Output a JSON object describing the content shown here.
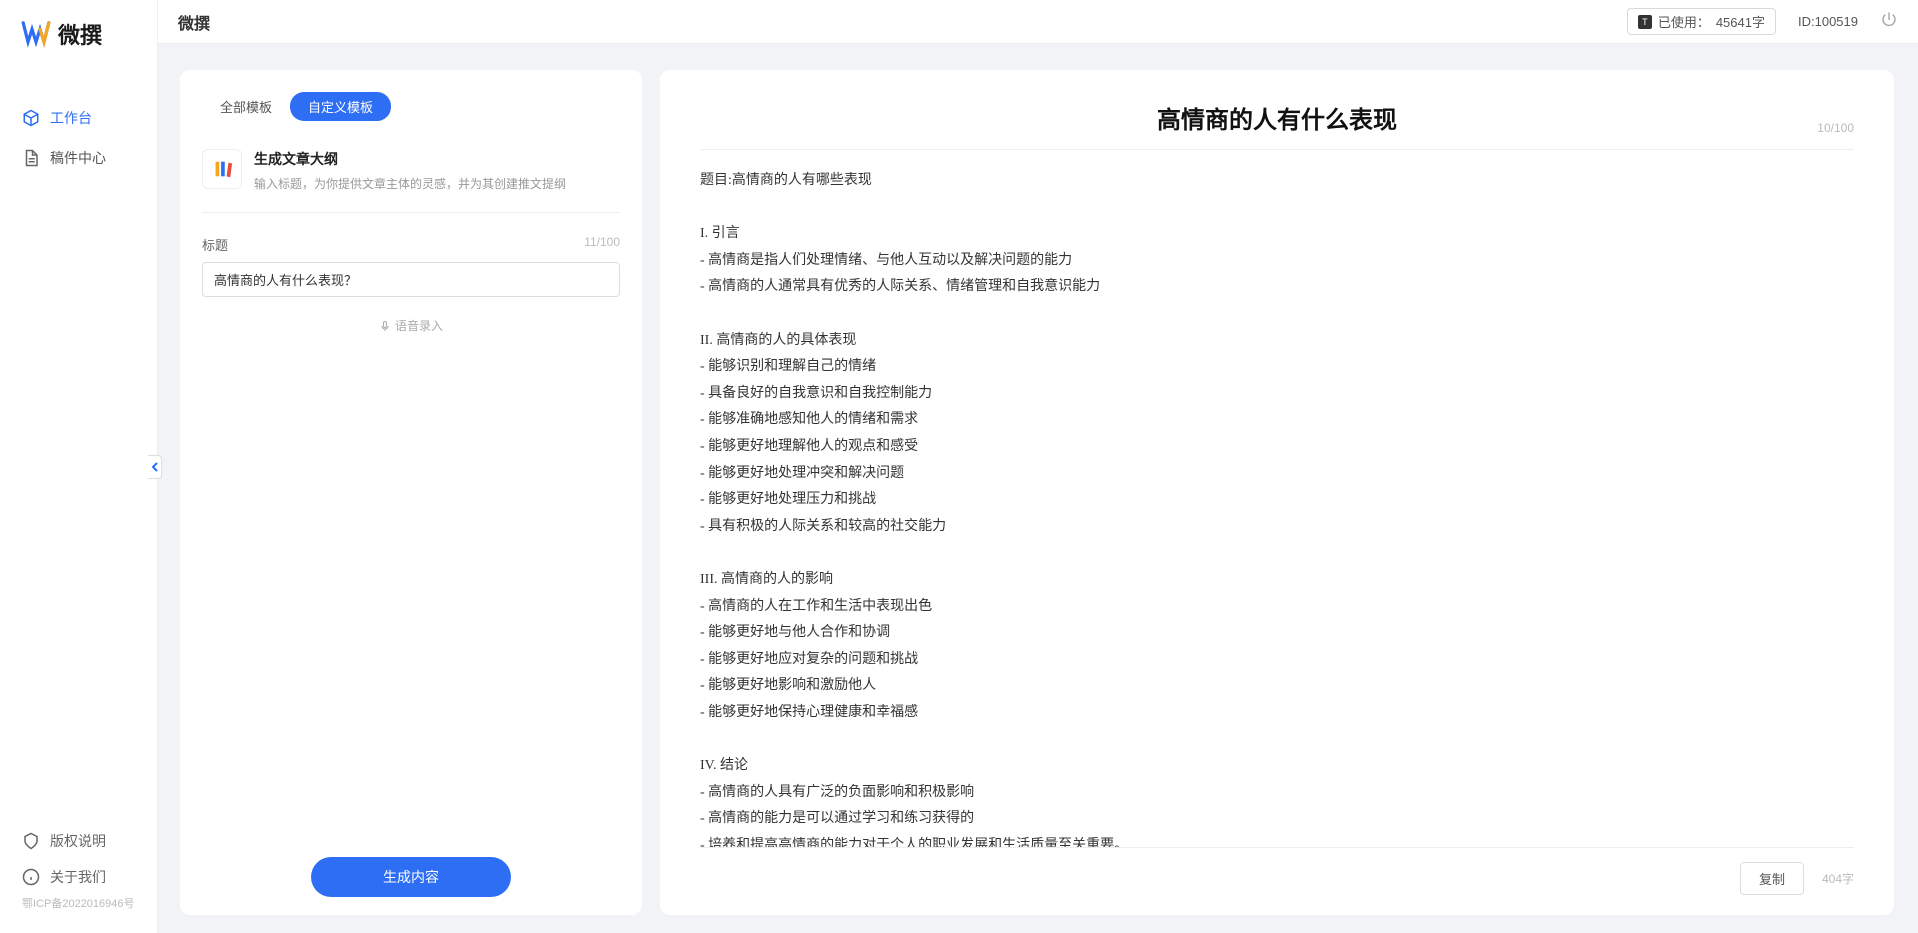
{
  "app": {
    "name": "微撰"
  },
  "sidebar": {
    "logo_text": "微撰",
    "nav": [
      {
        "icon": "cube",
        "label": "工作台",
        "active": true
      },
      {
        "icon": "doc",
        "label": "稿件中心",
        "active": false
      }
    ],
    "footer": [
      {
        "icon": "shield",
        "label": "版权说明"
      },
      {
        "icon": "info",
        "label": "关于我们"
      }
    ],
    "icp": "鄂ICP备2022016946号"
  },
  "topbar": {
    "title": "微撰",
    "usage_label": "已使用：",
    "usage_value": "45641字",
    "id_label": "ID:",
    "id_value": "100519"
  },
  "left_panel": {
    "tabs": [
      "全部模板",
      "自定义模板"
    ],
    "active_tab": 1,
    "template": {
      "title": "生成文章大纲",
      "desc": "输入标题，为你提供文章主体的灵感，并为其创建推文提纲"
    },
    "field_label": "标题",
    "char_count": "11/100",
    "input_value": "高情商的人有什么表现？",
    "record_hint": "语音录入",
    "generate_label": "生成内容"
  },
  "right_panel": {
    "title": "高情商的人有什么表现",
    "title_count": "10/100",
    "body": "题目:高情商的人有哪些表现\n\nI. 引言\n- 高情商是指人们处理情绪、与他人互动以及解决问题的能力\n- 高情商的人通常具有优秀的人际关系、情绪管理和自我意识能力\n\nII. 高情商的人的具体表现\n- 能够识别和理解自己的情绪\n- 具备良好的自我意识和自我控制能力\n- 能够准确地感知他人的情绪和需求\n- 能够更好地理解他人的观点和感受\n- 能够更好地处理冲突和解决问题\n- 能够更好地处理压力和挑战\n- 具有积极的人际关系和较高的社交能力\n\nIII. 高情商的人的影响\n- 高情商的人在工作和生活中表现出色\n- 能够更好地与他人合作和协调\n- 能够更好地应对复杂的问题和挑战\n- 能够更好地影响和激励他人\n- 能够更好地保持心理健康和幸福感\n\nIV. 结论\n- 高情商的人具有广泛的负面影响和积极影响\n- 高情商的能力是可以通过学习和练习获得的\n- 培养和提高高情商的能力对于个人的职业发展和生活质量至关重要。",
    "copy_label": "复制",
    "word_count": "404字"
  }
}
